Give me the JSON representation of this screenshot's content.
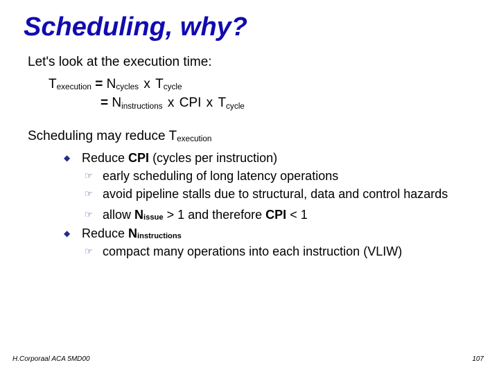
{
  "title": "Scheduling, why?",
  "intro": "Let's look at the execution time:",
  "eq1": {
    "T": "T",
    "Tsub": "execution",
    "eq": " = ",
    "N": "N",
    "Nsub": "cycles",
    "x1": " x ",
    "T2": "T",
    "T2sub": "cycle"
  },
  "eq2": {
    "eq": " = ",
    "N": "N",
    "Nsub": "instructions",
    "x1": " x ",
    "CPI": "CPI",
    "x2": " x ",
    "T2": "T",
    "T2sub": "cycle"
  },
  "para2_a": "Scheduling may reduce ",
  "para2_T": "T",
  "para2_Tsub": "execution",
  "b1_a": "Reduce ",
  "b1_b": "CPI",
  "b1_c": " (cycles per instruction)",
  "b1_1": "early scheduling of long latency operations",
  "b1_2": "avoid pipeline stalls due to structural, data and control hazards",
  "b1_3_a": "allow ",
  "b1_3_N": "N",
  "b1_3_Nsub": "issue",
  "b1_3_b": " > 1 and therefore ",
  "b1_3_CPI": "CPI",
  "b1_3_c": " < 1",
  "b2_a": "Reduce ",
  "b2_N": "N",
  "b2_Nsub": "instructions",
  "b2_1": "compact many operations into each instruction (VLIW)",
  "footer": {
    "left": "H.Corporaal  ACA 5MD00",
    "right": "107"
  }
}
